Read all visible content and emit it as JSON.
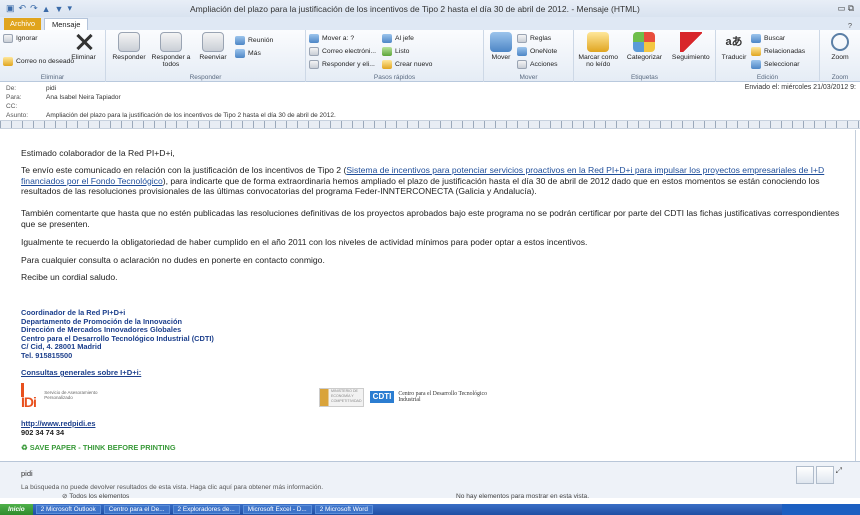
{
  "window": {
    "title": "Ampliación del plazo para la justificación de los incentivos de Tipo 2 hasta el día 30 de abril de 2012. - Mensaje (HTML)"
  },
  "tabs": {
    "file": "Archivo",
    "message": "Mensaje"
  },
  "ribbon": {
    "eliminar": {
      "name": "Eliminar",
      "ignore": "Ignorar",
      "junk": "Correo no deseado",
      "delete": "Eliminar"
    },
    "responder": {
      "name": "Responder",
      "reply": "Responder",
      "reply_all": "Responder a todos",
      "forward": "Reenviar",
      "meeting": "Reunión",
      "more": "Más"
    },
    "pasos": {
      "name": "Pasos rápidos",
      "move_to": "Mover a: ?",
      "to_manager": "Al jefe",
      "team_email": "Correo electróni...",
      "done": "Listo",
      "reply_delete": "Responder y eli...",
      "create_new": "Crear nuevo"
    },
    "mover": {
      "name": "Mover",
      "move": "Mover",
      "rules": "Reglas",
      "onenote": "OneNote",
      "actions": "Acciones"
    },
    "etiquetas": {
      "name": "Etiquetas",
      "mark_unread": "Marcar como no leído",
      "categorize": "Categorizar",
      "followup": "Seguimiento"
    },
    "edicion": {
      "name": "Edición",
      "translate": "Traducir",
      "find": "Buscar",
      "related": "Relacionadas",
      "select": "Seleccionar"
    },
    "zoom": {
      "name": "Zoom",
      "zoom": "Zoom"
    }
  },
  "header": {
    "from_label": "De:",
    "from": "pidi",
    "to_label": "Para:",
    "to": "Ana Isabel Neira Tapiador",
    "cc_label": "CC:",
    "subject_label": "Asunto:",
    "subject": "Ampliación del plazo para la justificación de los incentivos de Tipo 2 hasta el día 30 de abril de 2012.",
    "sent": "Enviado el:  miércoles 21/03/2012 9:"
  },
  "body": {
    "greeting": "Estimado colaborador de la Red PI+D+i,",
    "p1_a": "Te envío este comunicado en relación con la justificación de los incentivos de Tipo 2 (",
    "p1_link": "Sistema de incentivos para potenciar servicios proactivos en la Red PI+D+i para impulsar los proyectos empresariales de I+D financiados por el Fondo Tecnológico",
    "p1_b": "), para indicarte que de forma extraordinaria hemos ampliado el plazo de justificación hasta el día 30 de abril de 2012 dado que en estos momentos se están conociendo los resultados de las resoluciones provisionales de las últimas convocatorias del programa Feder-INNTERCONECTA (Galicia y Andalucía).",
    "p2": "También comentarte que hasta que no estén publicadas las resoluciones definitivas de los proyectos aprobados bajo este programa no se podrán certificar por parte del CDTI las fichas justificativas correspondientes que se presenten.",
    "p3": "Igualmente te recuerdo la obligatoriedad de haber cumplido en el año 2011 con los niveles de actividad mínimos para poder optar a estos incentivos.",
    "p4": "Para cualquier consulta o aclaración no dudes en ponerte en contacto conmigo.",
    "closing": "Recibe un cordial saludo."
  },
  "signature": {
    "lines": [
      "Coordinador de la Red PI+D+i",
      "Departamento de Promoción de la Innovación",
      "Dirección de Mercados Innovadores Globales",
      "Centro para el Desarrollo Tecnológico Industrial (CDTI)",
      "C/ Cid, 4. 28001 Madrid",
      "Tel. 915815500"
    ],
    "consultas": "Consultas generales sobre I+D+i:",
    "idi_logo": "IDi",
    "idi_sub": "Servicio de Asesoramiento Personalizado",
    "ministerio": "MINISTERIO DE ECONOMÍA Y COMPETITIVIDAD",
    "cdti_badge": "CDTI",
    "cdti_name": "Centro para el Desarrollo Tecnológico Industrial",
    "website": "http://www.redpidi.es",
    "phone": "902 34 74 34",
    "eco": "SAVE PAPER - THINK BEFORE PRINTING"
  },
  "people_pane": {
    "name": "pidi",
    "note": "La búsqueda no puede devolver resultados de esta vista. Haga clic aquí para obtener más información.",
    "all_items": "Todos los elementos",
    "no_items": "No hay elementos para mostrar en esta vista."
  },
  "taskbar": {
    "start": "Inicio",
    "items": [
      "2 Microsoft Outlook",
      "Centro para el De...",
      "2 Exploradores de...",
      "Microsoft Excel - D...",
      "2 Microsoft Word"
    ]
  }
}
